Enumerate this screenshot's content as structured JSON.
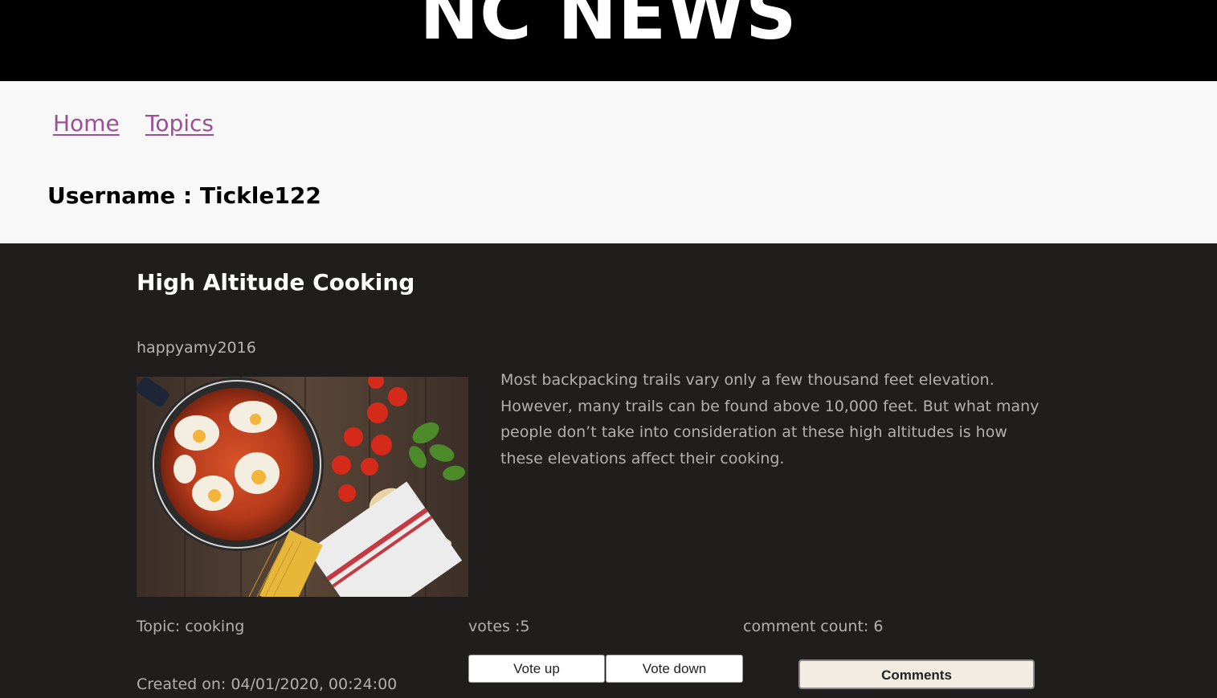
{
  "header": {
    "title": "NC NEWS"
  },
  "nav": {
    "home_label": "Home",
    "topics_label": "Topics"
  },
  "user": {
    "username_line": "Username : Tickle122"
  },
  "article": {
    "title": "High Altitude Cooking",
    "author": "happyamy2016",
    "body": "Most backpacking trails vary only a few thousand feet elevation. However, many trails can be found above 10,000 feet. But what many people don’t take into consideration at these high altitudes is how these elevations affect their cooking.",
    "topic_text": "Topic: cooking",
    "votes_text": "votes :5",
    "comment_count_text": "comment count: 6",
    "created_text": "Created on: 04/01/2020, 00:24:00",
    "vote_up_label": "Vote up",
    "vote_down_label": "Vote down",
    "comments_label": "Comments",
    "image_icon": "cooking-photo"
  },
  "colors": {
    "header_bg": "#000000",
    "nav_link": "#9b4f96",
    "article_bg": "#1f1e1d",
    "comments_button_bg": "#f3ece3"
  }
}
